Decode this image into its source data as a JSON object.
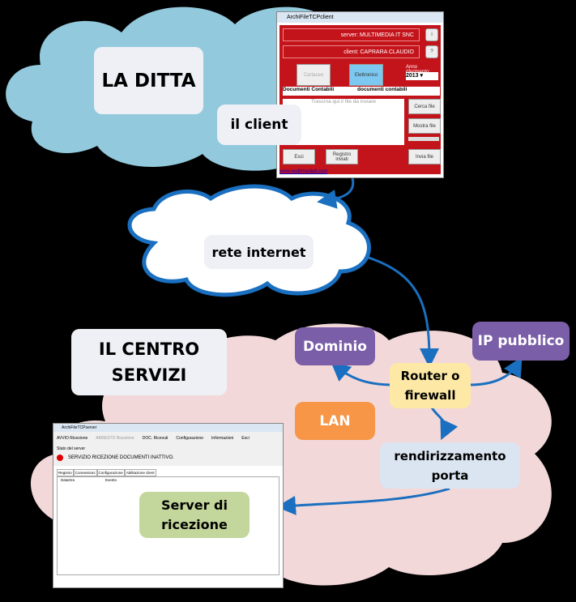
{
  "labels": {
    "la_ditta": "LA DITTA",
    "il_client": "il client",
    "rete_internet": "rete internet",
    "il_centro_servizi": "IL CENTRO SERVIZI",
    "dominio": "Dominio",
    "ip_pubblico": "IP pubblico",
    "router": "Router o firewall",
    "lan": "LAN",
    "rendirizzamento": "rendirizzamento porta",
    "server_ricezione": "Server di ricezione"
  },
  "colors": {
    "client_cloud": "#92c9dc",
    "internet_cloud_stroke": "#1a6fc0",
    "centro_cloud": "#f2d8d8",
    "arrow": "#1a6fc0",
    "purple": "#7b5ea8",
    "router": "#fde9a5",
    "lan": "#f79646",
    "server_label": "#c3d69b",
    "rendir": "#dbe5f1",
    "client_red": "#c4141b"
  },
  "client_window": {
    "title": "ArchiFileTCPclient",
    "server": "server: MULTIMEDIA IT SNC",
    "client": "client: CAPRARA CLAUDIO",
    "cartaceo": "Cartaceo",
    "elettronico": "Elettronico",
    "anno_label": "Anno riferimento:",
    "anno": "2013",
    "doc_type": "Documenti Contabili",
    "doc_sub": "documenti contabili",
    "drop_hint": "Trascina qui il file da inviare",
    "cerca": "Cerca file",
    "mostra": "Mostra file",
    "esci": "Esci",
    "registro": "Registro inviati",
    "invia": "Invia file",
    "link": "www.multimediait.com"
  },
  "server_window": {
    "title": "ArchiFileTCPserver",
    "toolbar": [
      "AVVIO Ricezione",
      "ARRESTO Ricezione",
      "DOC. Ricevuti",
      "Configurazione",
      "Informazioni",
      "Esci"
    ],
    "stato_label": "Stato del server",
    "stato": "SERVIZIO RICEZIONE DOCUMENTI INATTIVO.",
    "tabs": [
      "Registro",
      "Connessioni",
      "Configurazione",
      "Abilitazione client"
    ],
    "columns": [
      "DataOra",
      "Evento"
    ]
  }
}
